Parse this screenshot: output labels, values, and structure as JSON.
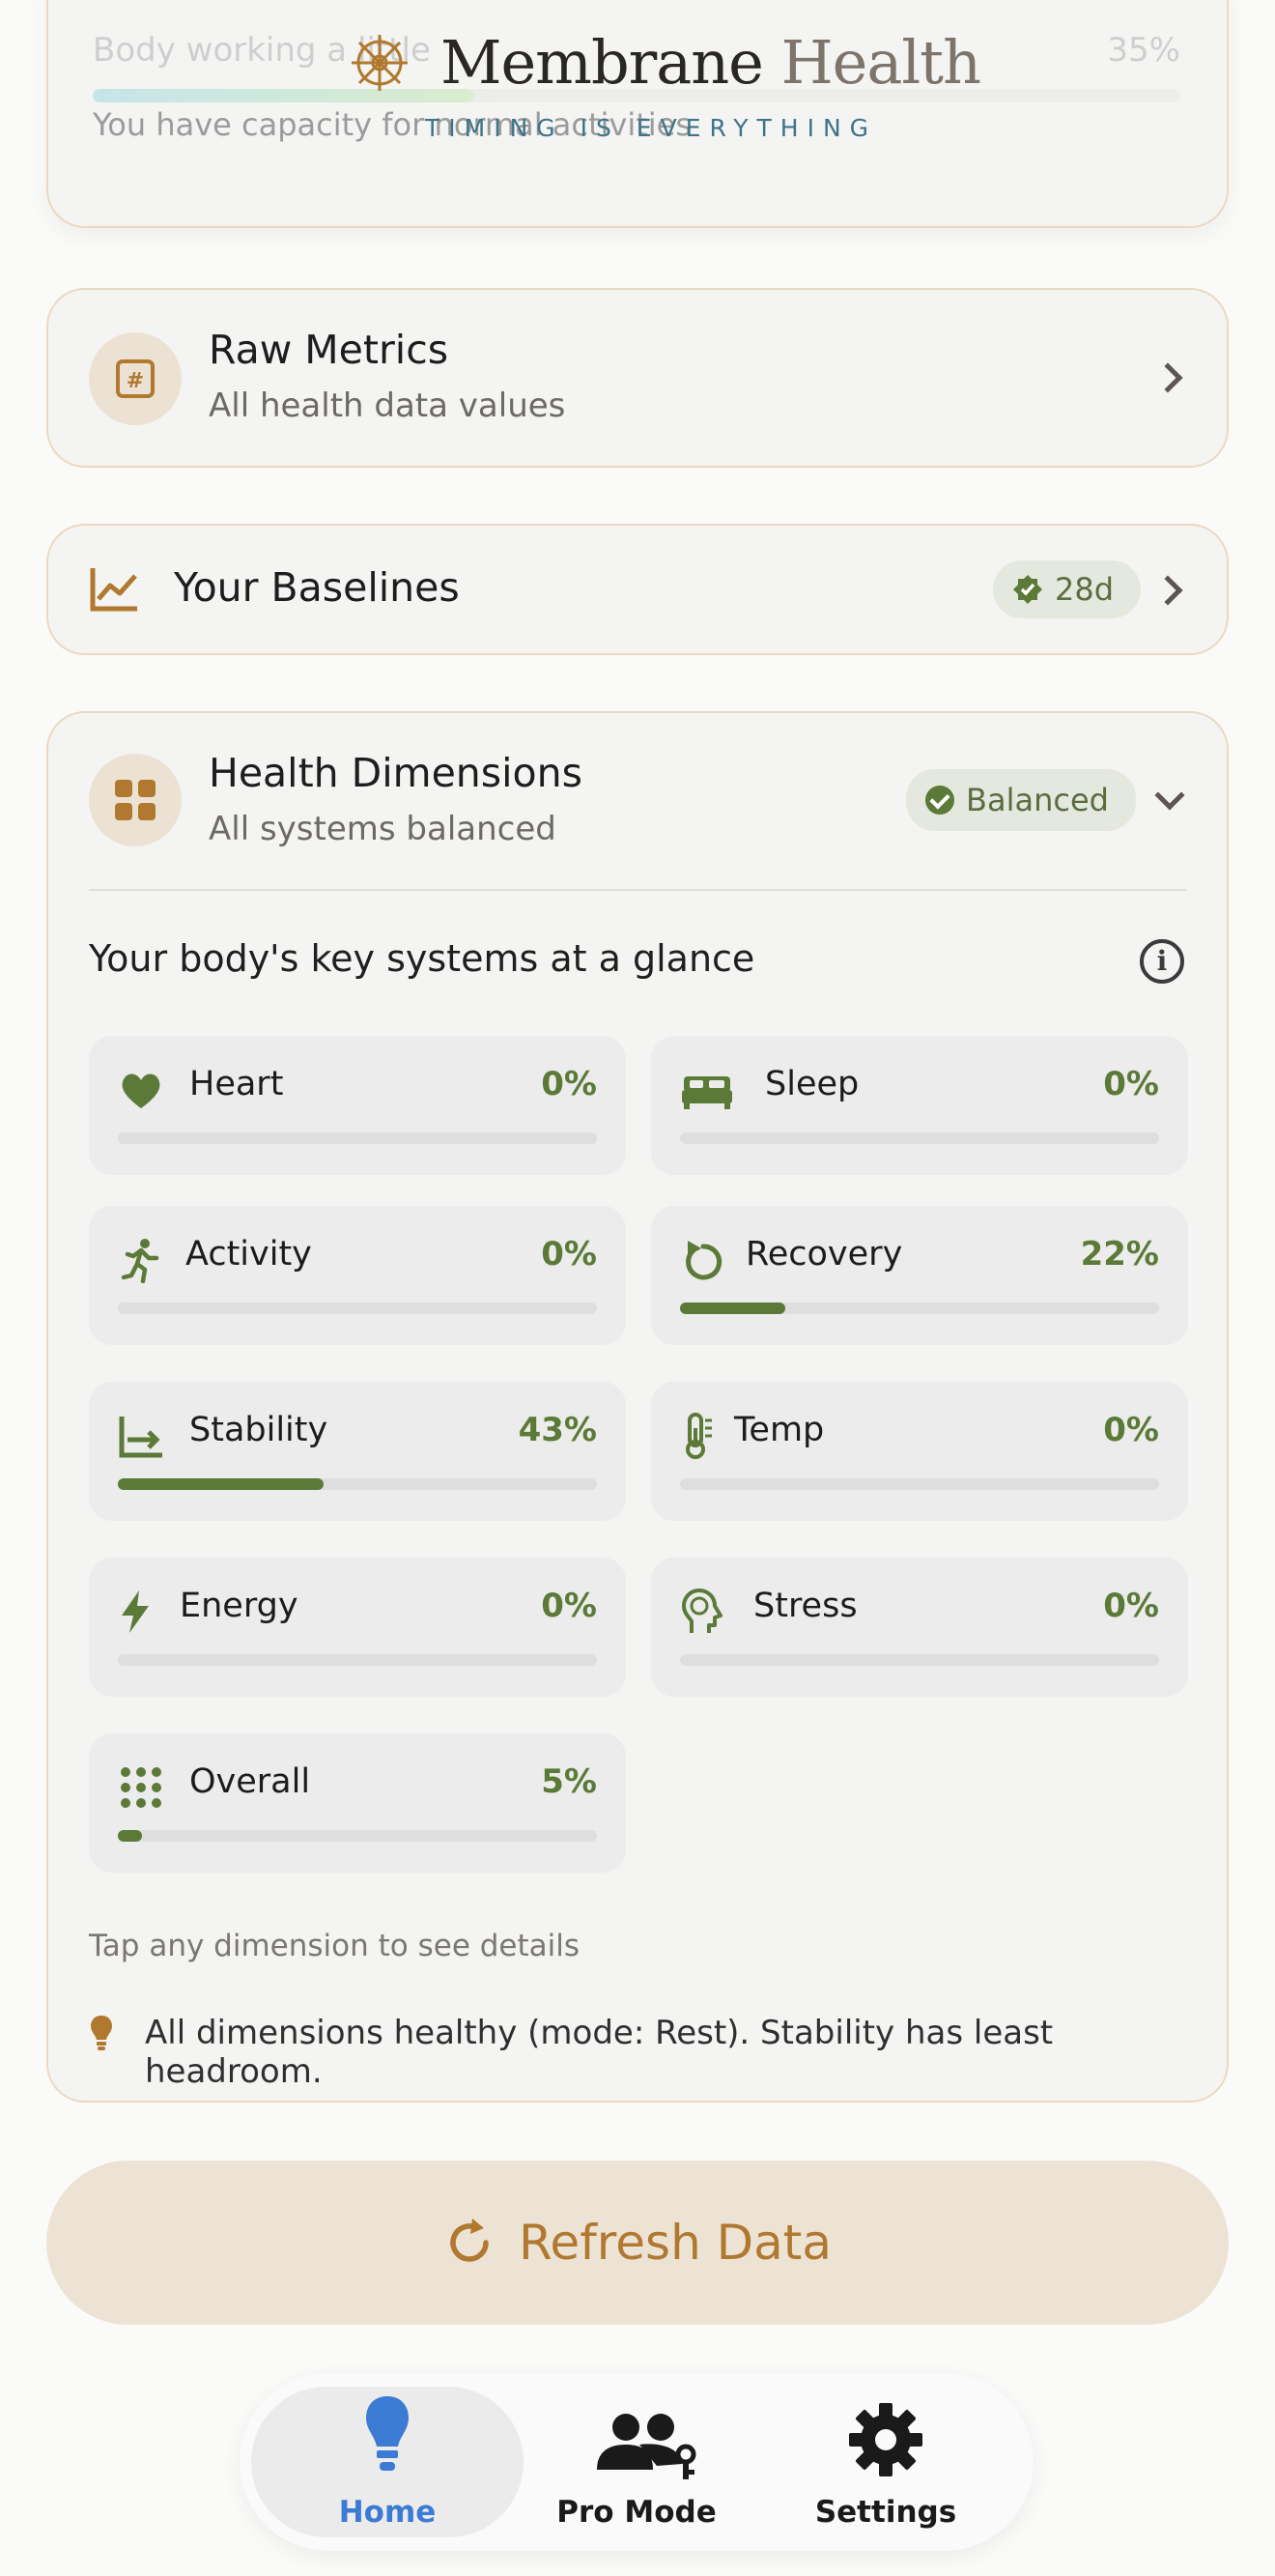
{
  "brand": {
    "name_main": "Membrane",
    "name_light": "Health",
    "tagline": "TIMING IS EVERYTHING"
  },
  "top_card": {
    "title": "Body working a little",
    "percent": "35%",
    "progress": 0.35,
    "description": "You have capacity for normal activities"
  },
  "raw_metrics": {
    "title": "Raw Metrics",
    "subtitle": "All health data values",
    "icon": "hash-icon"
  },
  "baselines": {
    "title": "Your Baselines",
    "badge": "28d",
    "icon": "trend-chart-icon"
  },
  "health_dimensions": {
    "title": "Health Dimensions",
    "subtitle": "All systems balanced",
    "status": "Balanced",
    "glance": "Your body's key systems at a glance",
    "tiles": [
      {
        "label": "Heart",
        "value": "0%",
        "progress": 0.0,
        "icon": "heart-icon"
      },
      {
        "label": "Sleep",
        "value": "0%",
        "progress": 0.0,
        "icon": "bed-icon"
      },
      {
        "label": "Activity",
        "value": "0%",
        "progress": 0.0,
        "icon": "running-icon"
      },
      {
        "label": "Recovery",
        "value": "22%",
        "progress": 0.22,
        "icon": "rotate-icon"
      },
      {
        "label": "Stability",
        "value": "43%",
        "progress": 0.43,
        "icon": "stability-icon"
      },
      {
        "label": "Temp",
        "value": "0%",
        "progress": 0.0,
        "icon": "thermometer-icon"
      },
      {
        "label": "Energy",
        "value": "0%",
        "progress": 0.0,
        "icon": "lightning-icon"
      },
      {
        "label": "Stress",
        "value": "0%",
        "progress": 0.0,
        "icon": "brain-head-icon"
      },
      {
        "label": "Overall",
        "value": "5%",
        "progress": 0.05,
        "icon": "grid-dots-icon"
      }
    ],
    "hint": "Tap any dimension to see details",
    "tip": "All dimensions healthy (mode: Rest). Stability has least headroom."
  },
  "refresh": {
    "label": "Refresh Data"
  },
  "nav": [
    {
      "label": "Home",
      "icon": "bulb-icon",
      "active": true
    },
    {
      "label": "Pro Mode",
      "icon": "users-key-icon",
      "active": false
    },
    {
      "label": "Settings",
      "icon": "gear-icon",
      "active": false
    }
  ],
  "colors": {
    "accent": "#5b7a38",
    "brand_gold": "#b0792f",
    "nav_active": "#3c7bd4",
    "tagline": "#3e7488"
  }
}
